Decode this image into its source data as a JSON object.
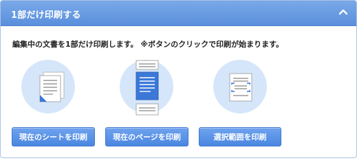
{
  "header": {
    "title": "1部だけ印刷する"
  },
  "description": "編集中の文書を1部だけ印刷します。 ※ボタンのクリックで印刷が始まります。",
  "options": [
    {
      "icon": "current-sheet-print-icon",
      "button_label": "現在のシートを印刷"
    },
    {
      "icon": "current-page-print-icon",
      "button_label": "現在のページを印刷"
    },
    {
      "icon": "selection-print-icon",
      "button_label": "選択範囲を印刷"
    }
  ],
  "colors": {
    "header_bg": "#5a8fdc",
    "button_bg": "#4a86e0",
    "icon_circle": "#d6e6fa",
    "accent": "#3b78d8"
  }
}
